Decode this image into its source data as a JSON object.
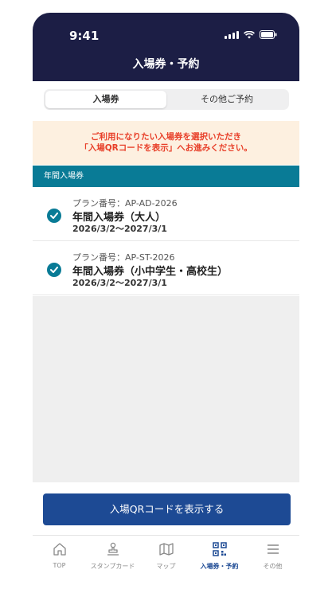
{
  "status": {
    "time": "9:41"
  },
  "header": {
    "title": "入場券・予約"
  },
  "tabs": [
    {
      "label": "入場券",
      "active": true
    },
    {
      "label": "その他ご予約",
      "active": false
    }
  ],
  "notice": {
    "line1": "ご利用になりたい入場券を選択いただき",
    "line2": "「入場QRコードを表示」へお進みください。"
  },
  "section": {
    "title": "年間入場券"
  },
  "tickets": [
    {
      "plan": "プラン番号：AP-AD-2026",
      "name": "年間入場券（大人）",
      "period": "2026/3/2〜2027/3/1",
      "checked": true
    },
    {
      "plan": "プラン番号：AP-ST-2026",
      "name": "年間入場券（小中学生・高校生）",
      "period": "2026/3/2〜2027/3/1",
      "checked": true
    }
  ],
  "cta": {
    "label": "入場QRコードを表示する"
  },
  "tabbar": [
    {
      "label": "TOP",
      "icon": "home-icon"
    },
    {
      "label": "スタンプカード",
      "icon": "stamp-icon"
    },
    {
      "label": "マップ",
      "icon": "map-icon"
    },
    {
      "label": "入場券・予約",
      "icon": "qr-code-icon",
      "active": true
    },
    {
      "label": "その他",
      "icon": "menu-icon"
    }
  ],
  "colors": {
    "header_bg": "#1c1e45",
    "accent": "#097b96",
    "button": "#1d4a94",
    "notice_text": "#e8402a",
    "notice_bg": "#fdf0e0"
  }
}
